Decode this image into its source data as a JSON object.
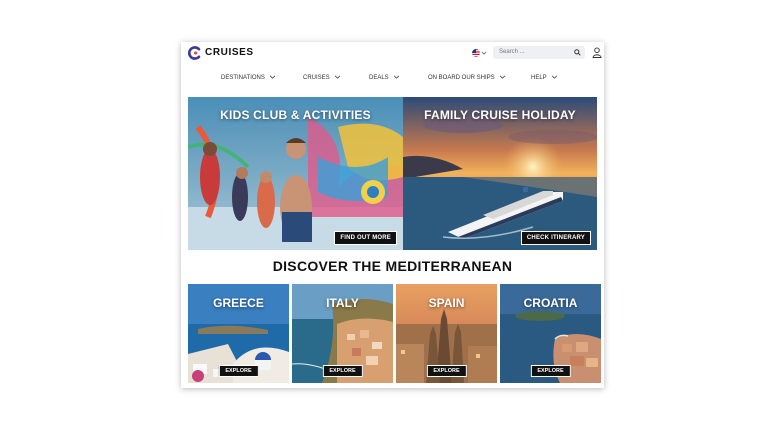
{
  "brand": {
    "name": "CRUISES",
    "logo_icon": "c-logo-icon",
    "accent": "#3b3b9e"
  },
  "header": {
    "search_placeholder": "Search ...",
    "flag_icon": "us-flag-icon",
    "user_icon": "user-icon"
  },
  "nav": {
    "items": [
      {
        "label": "DESTINATIONS"
      },
      {
        "label": "CRUISES"
      },
      {
        "label": "DEALS"
      },
      {
        "label": "ON BOARD OUR SHIPS"
      },
      {
        "label": "HELP"
      }
    ]
  },
  "hero": [
    {
      "title": "KIDS CLUB & ACTIVITIES",
      "cta": "FIND OUT MORE"
    },
    {
      "title": "FAMILY CRUISE HOLIDAY",
      "cta": "CHECK ITINERARY"
    }
  ],
  "discover": {
    "heading": "DISCOVER THE MEDITERRANEAN"
  },
  "destinations": [
    {
      "name": "GREECE",
      "cta": "EXPLORE"
    },
    {
      "name": "ITALY",
      "cta": "EXPLORE"
    },
    {
      "name": "SPAIN",
      "cta": "EXPLORE"
    },
    {
      "name": "CROATIA",
      "cta": "EXPLORE"
    }
  ]
}
